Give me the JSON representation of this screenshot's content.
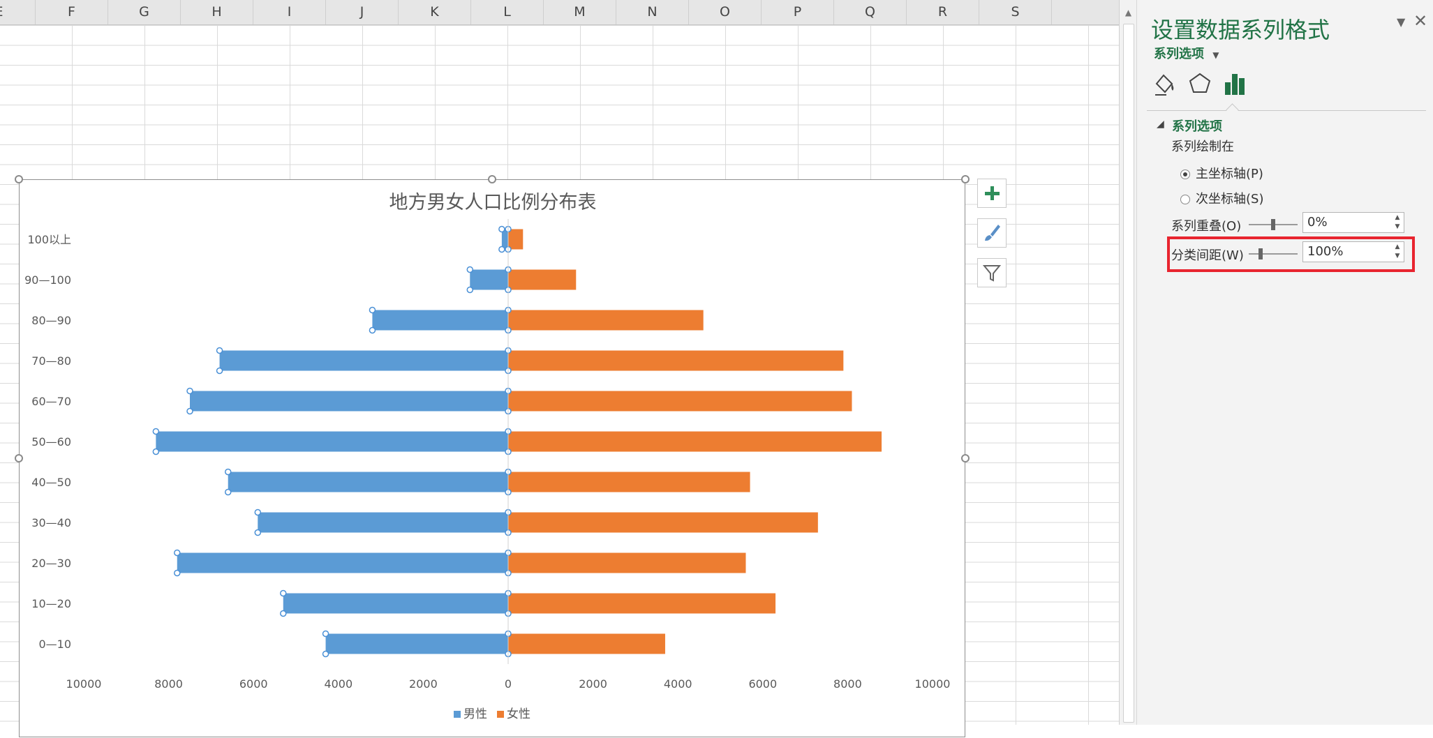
{
  "sheet": {
    "columns": [
      "E",
      "F",
      "G",
      "H",
      "I",
      "J",
      "K",
      "L",
      "M",
      "N",
      "O",
      "P",
      "Q",
      "R",
      "S"
    ]
  },
  "chart_data": {
    "type": "bar",
    "orientation": "horizontal",
    "title": "地方男女人口比例分布表",
    "categories": [
      "0—10",
      "10—20",
      "20—30",
      "30—40",
      "40—50",
      "50—60",
      "60—70",
      "70—80",
      "80—90",
      "90—100",
      "100以上"
    ],
    "series": [
      {
        "name": "男性",
        "color": "#5b9bd5",
        "values": [
          4300,
          5300,
          7800,
          5900,
          6600,
          8300,
          7500,
          6800,
          3200,
          900,
          150
        ]
      },
      {
        "name": "女性",
        "color": "#ed7d31",
        "values": [
          3700,
          6300,
          5600,
          7300,
          5700,
          8800,
          8100,
          7900,
          4600,
          1600,
          350
        ]
      }
    ],
    "x_tick_labels": [
      "10000",
      "8000",
      "6000",
      "4000",
      "2000",
      "0",
      "2000",
      "4000",
      "6000",
      "8000",
      "10000"
    ],
    "xlim": [
      -10000,
      10000
    ],
    "legend": "bottom",
    "grid": false
  },
  "chart_tools": {
    "add_element_icon": "plus-icon",
    "style_icon": "brush-icon",
    "filter_icon": "funnel-icon"
  },
  "pane": {
    "title": "设置数据系列格式",
    "options_dropdown": "系列选项",
    "tabs": [
      "fill-line-icon",
      "effects-pentagon-icon",
      "series-options-chart-icon"
    ],
    "section_title": "系列选项",
    "plot_series_on": "系列绘制在",
    "radio_primary": "主坐标轴(P)",
    "radio_secondary": "次坐标轴(S)",
    "overlap_label": "系列重叠(O)",
    "overlap_value": "0%",
    "gap_label": "分类间距(W)",
    "gap_value": "100%"
  },
  "colors": {
    "accent_green": "#217346",
    "highlight_red": "#e8242f",
    "male": "#5b9bd5",
    "female": "#ed7d31"
  }
}
